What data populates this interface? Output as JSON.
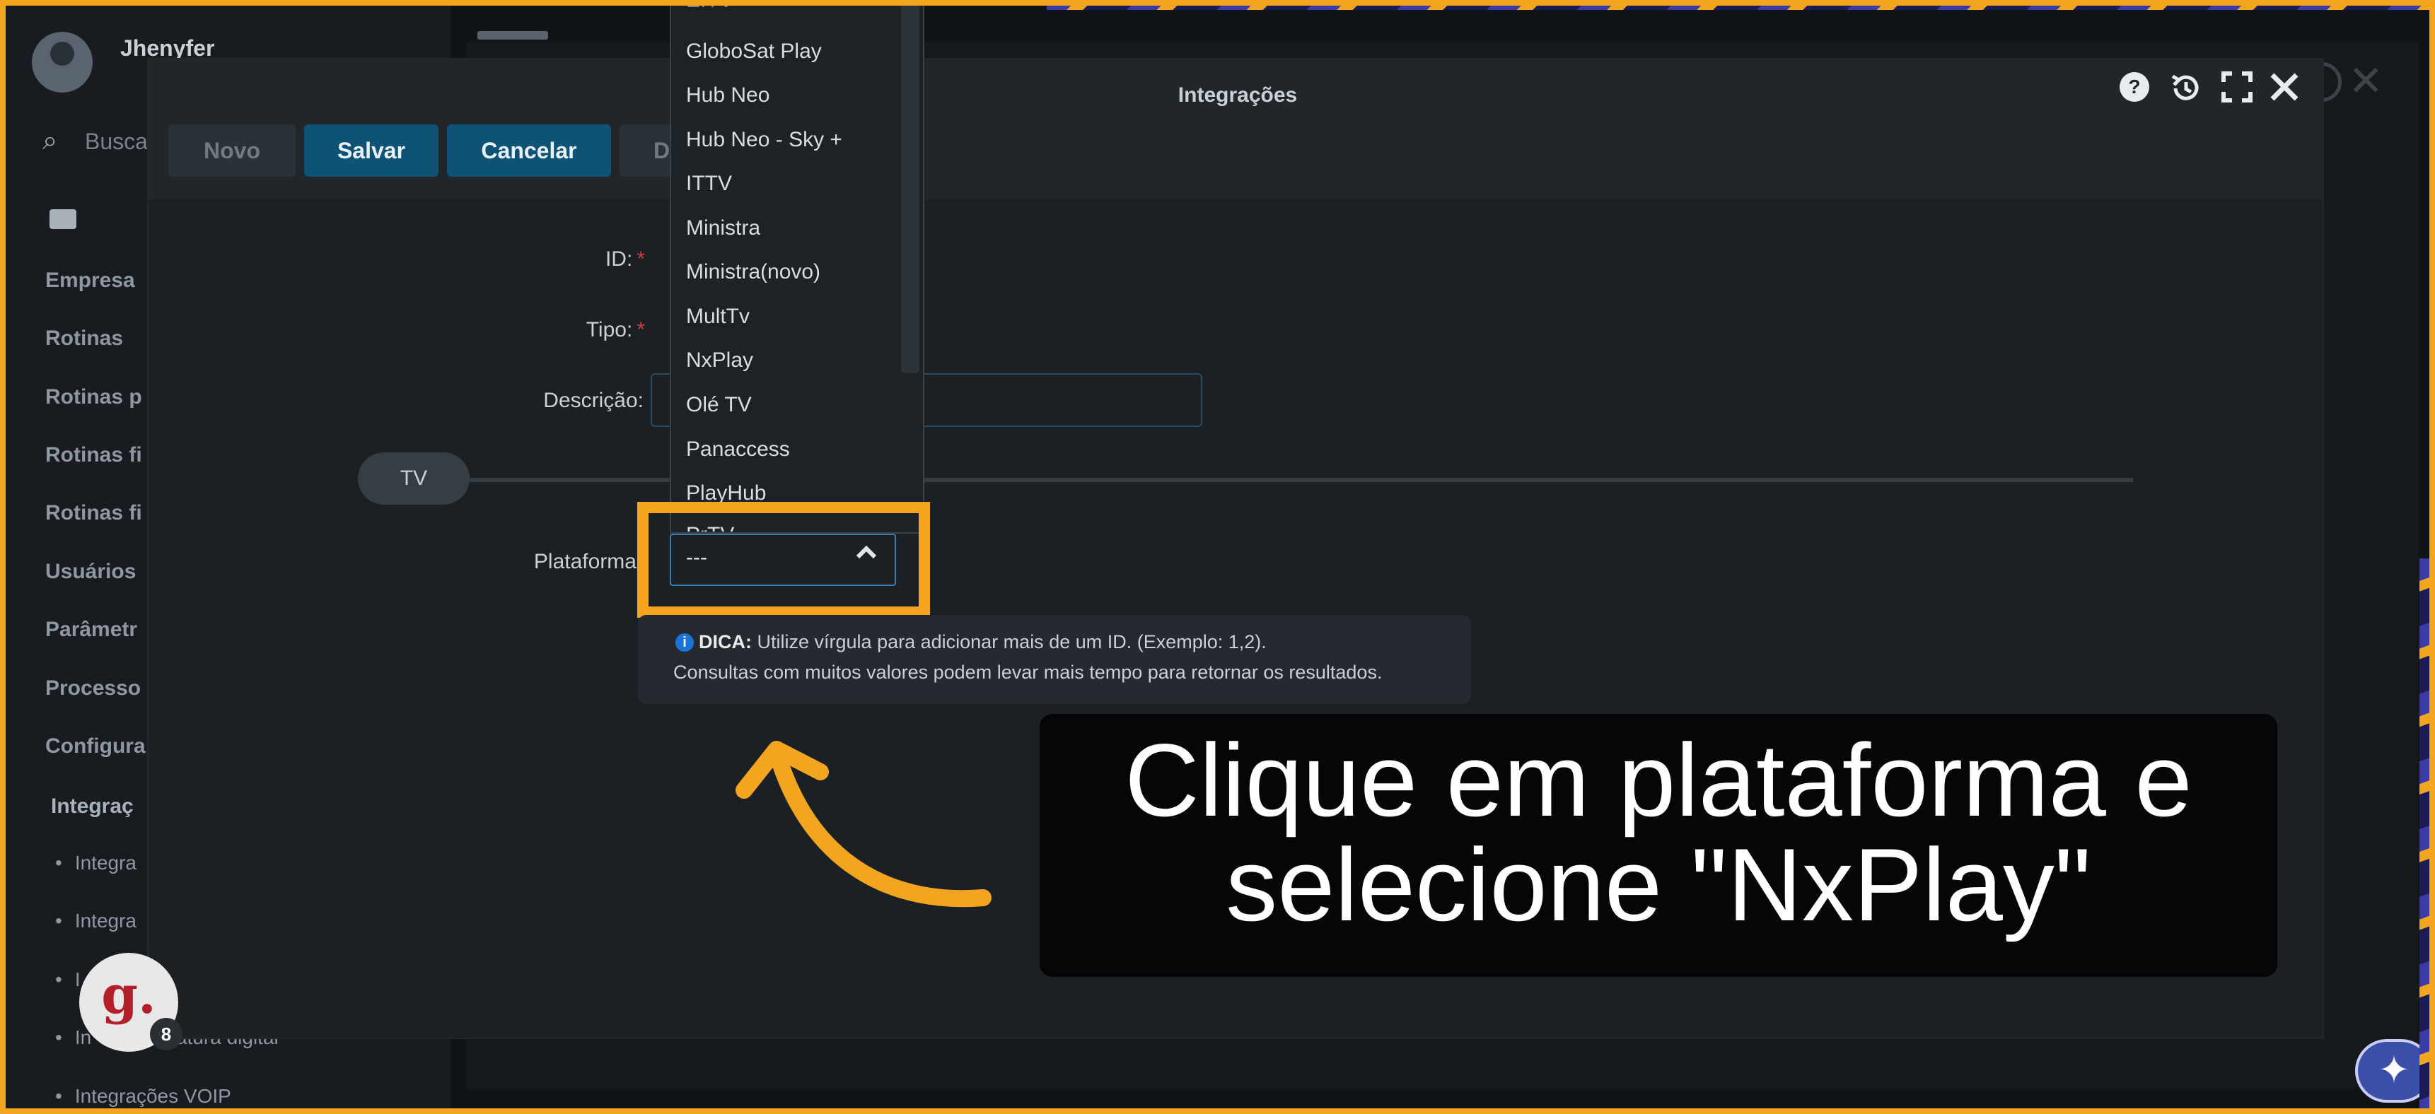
{
  "background_app": {
    "user_name": "Jhenyfer",
    "search_placeholder": "Busca",
    "menu_items": [
      "Empresa",
      "Rotinas",
      "Rotinas p",
      "Rotinas fi",
      "Rotinas fi",
      "Usuários",
      "Parâmetr",
      "Processo",
      "Configura"
    ],
    "active_section": "Integraç",
    "sub_items": [
      "Integra",
      "Integra",
      "I",
      "In       assinatura digital",
      "Integrações VOIP"
    ]
  },
  "modal": {
    "title": "Integrações",
    "toolbar": {
      "novo_label": "Novo",
      "salvar_label": "Salvar",
      "cancelar_label": "Cancelar",
      "d_label": "D"
    },
    "header_icons": [
      "help-icon",
      "history-icon",
      "fullscreen-icon",
      "close-icon"
    ],
    "form": {
      "id_label": "ID:",
      "tipo_label": "Tipo:",
      "descricao_label": "Descrição:",
      "required_mark": "*",
      "tab_label": "TV",
      "plataforma_label": "Plataforma",
      "plataforma_value": "---"
    },
    "dropdown_options": [
      "EITV",
      "GloboSat Play",
      "Hub Neo",
      "Hub Neo - Sky +",
      "ITTV",
      "Ministra",
      "Ministra(novo)",
      "MultTv",
      "NxPlay",
      "Olé TV",
      "Panaccess",
      "PlayHub",
      "PrTV"
    ],
    "tip": {
      "label": "DICA:",
      "line1": "Utilize vírgula para adicionar mais de um ID. (Exemplo: 1,2).",
      "line2": "Consultas com muitos valores podem levar mais tempo para retornar os resultados."
    }
  },
  "overlay": {
    "instruction": "Clique em plataforma e selecione \"NxPlay\"",
    "brand_letter": "g.",
    "brand_count": "8"
  },
  "colors": {
    "accent_orange": "#f3a51f",
    "button_blue": "#0e5276",
    "required_red": "#d03a3a"
  }
}
